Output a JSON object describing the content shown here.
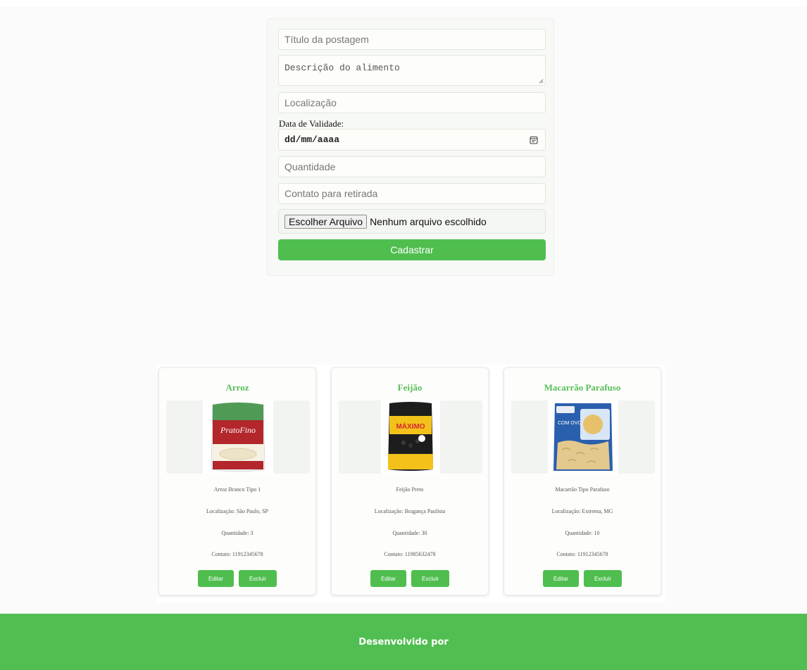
{
  "form": {
    "title_placeholder": "Título da postagem",
    "description_placeholder": "Descrição do alimento",
    "location_placeholder": "Localização",
    "date_label": "Data de Validade:",
    "date_value": "dd/mm/aaaa",
    "quantity_placeholder": "Quantidade",
    "contact_placeholder": "Contato para retirada",
    "file_button_label": "Escolher Arquivo",
    "file_status": "Nenhum arquivo escolhido",
    "submit_label": "Cadastrar"
  },
  "cards": [
    {
      "title": "Arroz",
      "description": "Arroz Branco Tipo 1",
      "location": "Localização: São Paulo, SP",
      "quantity": "Quantidade: 3",
      "contact": "Contato: 11912345678",
      "edit_label": "Editar",
      "delete_label": "Excluir"
    },
    {
      "title": "Feijão",
      "description": "Feijão Preto",
      "location": "Localização: Bragança Paulista",
      "quantity": "Quantidade: 30",
      "contact": "Contato: 11985632478",
      "edit_label": "Editar",
      "delete_label": "Excluir"
    },
    {
      "title": "Macarrão Parafuso",
      "description": "Macarrão Tipo Parafuso",
      "location": "Localização: Extrema, MG",
      "quantity": "Quantidade: 10",
      "contact": "Contato: 11912345678",
      "edit_label": "Editar",
      "delete_label": "Excluir"
    }
  ],
  "product_images": {
    "rice_brand": "PratoFino",
    "beans_brand": "MÁXIMO",
    "pasta_text": "COM OVOS"
  },
  "footer": {
    "text": "Desenvolvido por"
  },
  "colors": {
    "accent_green": "#4fbe4f",
    "title_green": "#58bd58"
  }
}
